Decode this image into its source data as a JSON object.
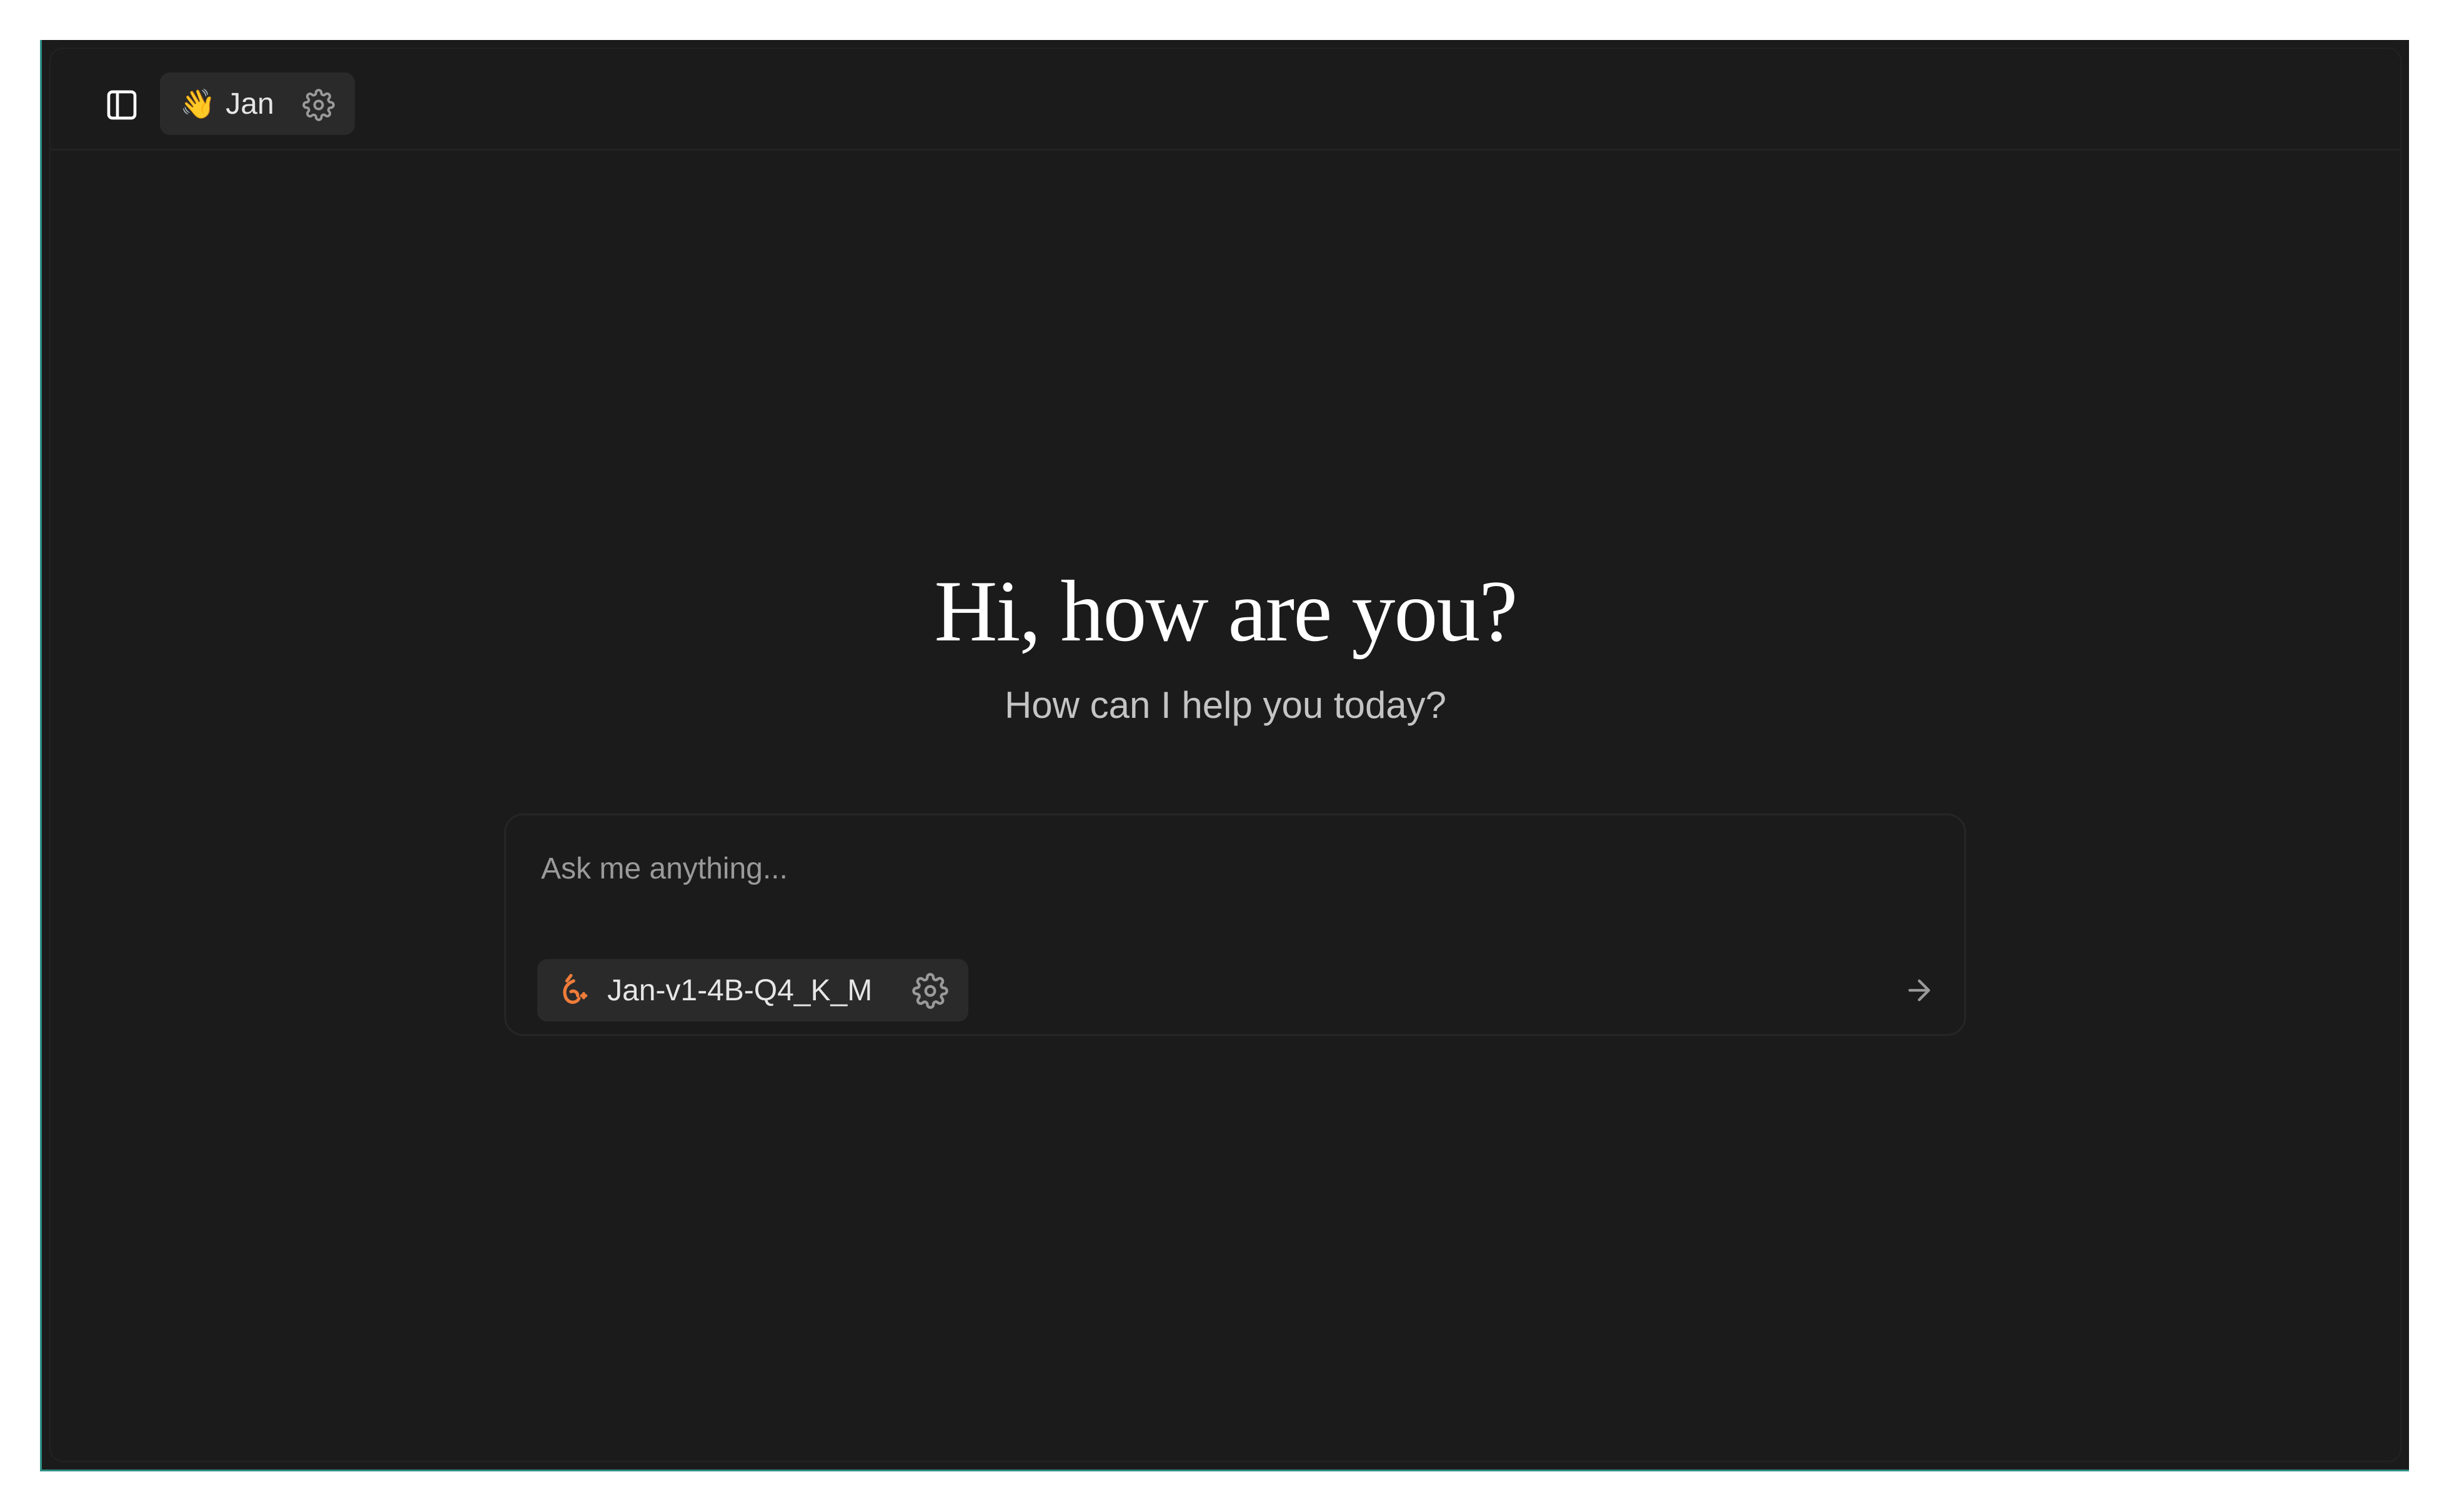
{
  "header": {
    "sidebar_toggle_icon": "sidebar-panel-icon",
    "assistant": {
      "emoji": "👋",
      "name": "Jan",
      "settings_icon": "gear-icon"
    }
  },
  "main": {
    "greeting": "Hi, how are you?",
    "subtitle": "How can I help you today?"
  },
  "composer": {
    "placeholder": "Ask me anything...",
    "value": "",
    "model": {
      "name": "Jan-v1-4B-Q4_K_M",
      "logo_icon": "jan-logo-icon",
      "settings_icon": "gear-icon"
    },
    "send_icon": "arrow-right-icon"
  },
  "colors": {
    "background": "#1b1b1b",
    "chip": "#2a2a2a",
    "accent_logo": "#f07c3a",
    "text_primary": "#ffffff",
    "text_secondary": "#c4c4c4",
    "placeholder": "#9a9a9a"
  }
}
